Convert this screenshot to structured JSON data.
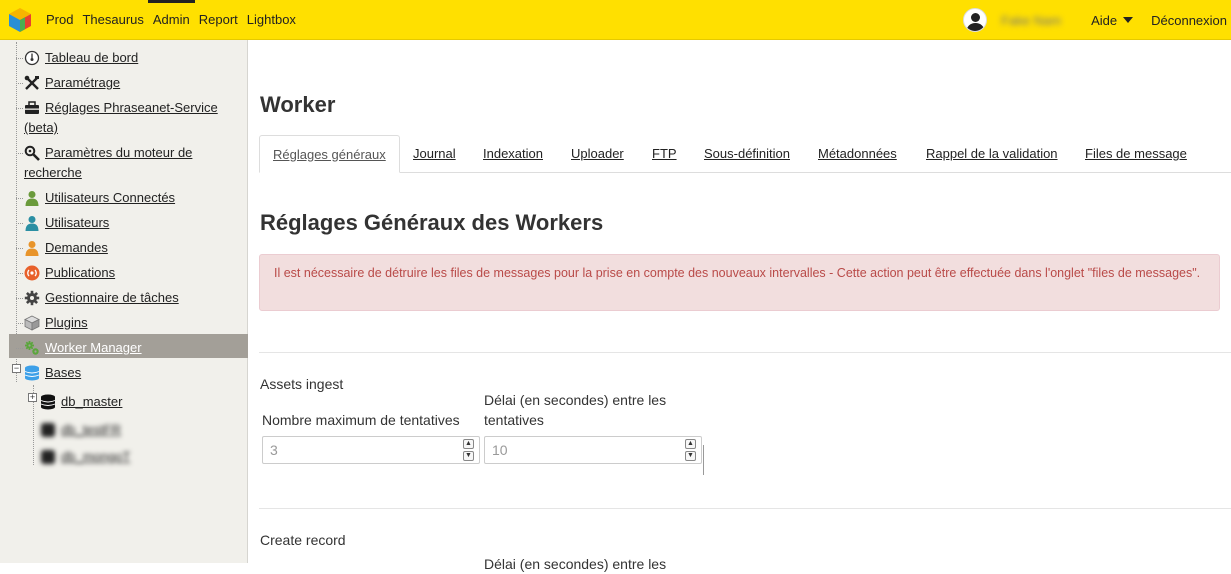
{
  "topbar": {
    "nav": [
      "Prod",
      "Thesaurus",
      "Admin",
      "Report",
      "Lightbox"
    ],
    "active_nav": "Admin",
    "username": "Fake Nam",
    "help_label": "Aide",
    "logout_label": "Déconnexion"
  },
  "sidebar": {
    "items": [
      {
        "label": "Tableau de bord",
        "icon": "dashboard-icon"
      },
      {
        "label": "Paramétrage",
        "icon": "tools-icon"
      },
      {
        "label": "Réglages Phraseanet-Service",
        "label2": "(beta)",
        "icon": "toolbox-icon"
      },
      {
        "label": "Paramètres du moteur de",
        "label2": "recherche",
        "icon": "search-gear-icon"
      },
      {
        "label": "Utilisateurs Connectés",
        "icon": "user-green-icon"
      },
      {
        "label": "Utilisateurs",
        "icon": "user-blue-icon"
      },
      {
        "label": "Demandes",
        "icon": "user-orange-icon"
      },
      {
        "label": "Publications",
        "icon": "rss-icon"
      },
      {
        "label": "Gestionnaire de tâches",
        "icon": "gear-icon"
      },
      {
        "label": "Plugins",
        "icon": "cube-icon"
      },
      {
        "label": "Worker Manager",
        "icon": "gears-green-icon",
        "selected": true
      }
    ],
    "bases_label": "Bases",
    "databases": [
      {
        "label": "db_master"
      },
      {
        "label": "db_testFR"
      },
      {
        "label": "db_mongoT"
      }
    ]
  },
  "main": {
    "page_title": "Worker",
    "tabs": [
      "Réglages généraux",
      "Journal",
      "Indexation",
      "Uploader",
      "FTP",
      "Sous-définition",
      "Métadonnées",
      "Rappel de la validation",
      "Files de message"
    ],
    "active_tab": "Réglages généraux",
    "section_title": "Réglages Généraux des Workers",
    "alert": "Il est nécessaire de détruire les files de messages pour la prise en compte des nouveaux intervalles - Cette action peut être effectuée dans l'onglet \"files de messages\".",
    "groups": [
      {
        "title": "Assets ingest",
        "max_attempts_label": "Nombre maximum de tentatives",
        "max_attempts_value": "3",
        "delay_label": "Délai (en secondes) entre les tentatives",
        "delay_value": "10"
      },
      {
        "title": "Create record",
        "delay_label": "Délai (en secondes) entre les"
      }
    ]
  },
  "colors": {
    "topbar": "#ffe000",
    "sidebar_bg": "#f1f0eb",
    "selected_bg": "#a39f98",
    "alert_bg": "#f2dede",
    "alert_text": "#b94a48"
  }
}
